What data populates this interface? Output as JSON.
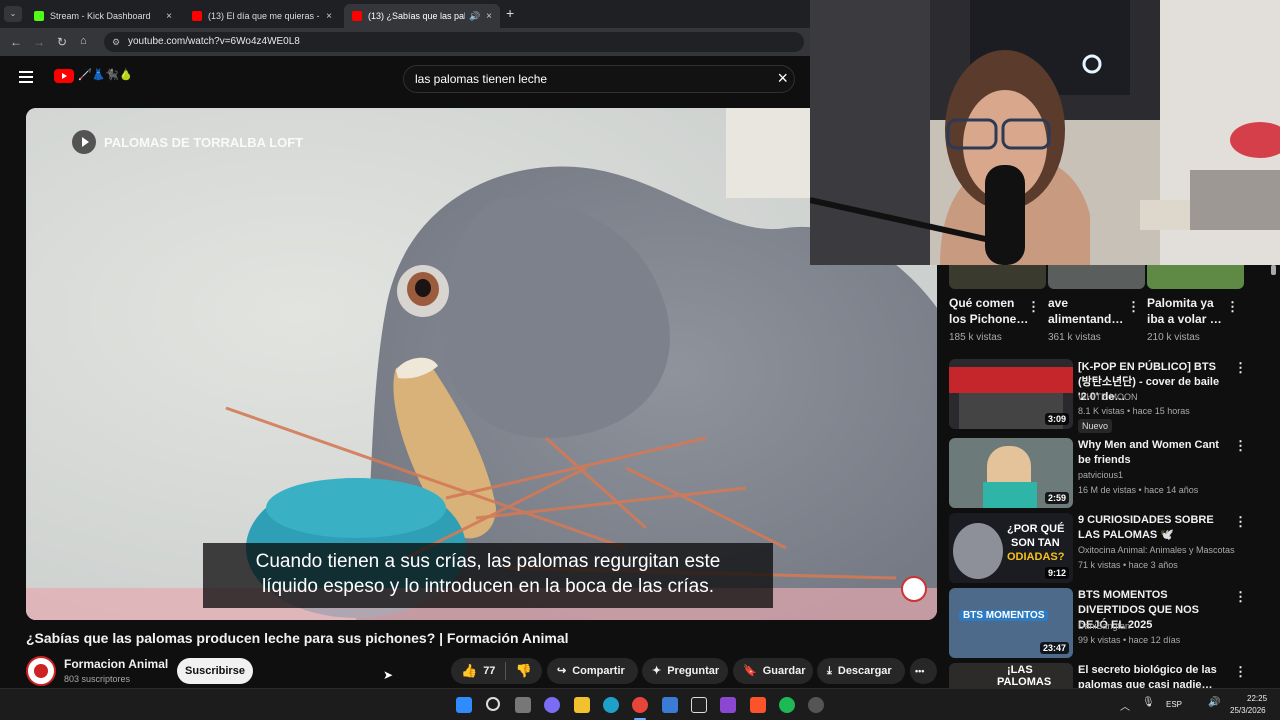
{
  "browser": {
    "tabs": [
      {
        "title": "Stream - Kick Dashboard",
        "close": "×"
      },
      {
        "title": "(13) El día que me quieras - Vid",
        "close": "×"
      },
      {
        "title": "(13) ¿Sabías que las paloma",
        "close": "×"
      }
    ],
    "new_tab": "+",
    "url": "youtube.com/watch?v=6Wo4z4WE0L8",
    "colors": {
      "kick": "#53fc18",
      "youtube": "#ff0000"
    }
  },
  "youtube": {
    "logo_extra": "🦯👗🐈‍⬛🍐",
    "search_query": "las palomas tienen leche",
    "clear_search": "×"
  },
  "video": {
    "overlay_channel": "PALOMAS DE TORRALBA LOFT",
    "caption_line1": "Cuando tienen a sus crías, las palomas regurgitan este",
    "caption_line2": "líquido espeso y lo introducen en la boca de las crías.",
    "title": "¿Sabías que las palomas producen leche para sus pichones? | Formación Animal",
    "channel_name": "Formacion Animal",
    "subscribers": "803 suscriptores",
    "subscribe_label": "Suscribirse",
    "likes": "77",
    "share_label": "Compartir",
    "ask_label": "Preguntar",
    "save_label": "Guardar",
    "download_label": "Descargar",
    "more_label": "•••"
  },
  "shorts": [
    {
      "title_line1": "Qué comen",
      "title_line2": "los Pichone…",
      "views": "185 k vistas"
    },
    {
      "title_line1": "ave",
      "title_line2": "alimentand…",
      "views": "361 k vistas"
    },
    {
      "title_line1": "Palomita ya",
      "title_line2": "iba a volar …",
      "views": "210 k vistas"
    }
  ],
  "recommendations": [
    {
      "title": "[K-POP EN PÚBLICO] BTS (방탄소년단) - cover de baile '2.0' de…",
      "channel": "WHITE MOON",
      "meta": "8.1 K vistas • hace 15 horas",
      "badge": "Nuevo",
      "duration": "3:09"
    },
    {
      "title": "Why Men and Women Cant be friends",
      "channel": "patvicious1",
      "meta": "16 M de vistas • hace 14 años",
      "duration": "2:59"
    },
    {
      "title": "9 CURIOSIDADES SOBRE LAS PALOMAS 🕊️",
      "channel": "Oxitocina Animal: Animales y Mascotas",
      "meta": "71 k vistas • hace 3 años",
      "duration": "9:12",
      "thumb_text1": "¿POR QUÉ",
      "thumb_text2": "SON TAN",
      "thumb_text3": "ODIADAS?"
    },
    {
      "title": "BTS MOMENTOS DIVERTIDOS QUE NOS DEJÓ EL 2025",
      "channel": "DaniBangtan",
      "meta": "99 k vistas • hace 12 días",
      "duration": "23:47",
      "thumb_text1": "BTS MOMENTOS"
    },
    {
      "title": "El secreto biológico de las palomas que casi nadie…",
      "thumb_text1": "¡LAS",
      "thumb_text2": "PALOMAS"
    }
  ],
  "taskbar": {
    "lang": "ESP",
    "time": "22:25",
    "date": "25/3/2026"
  }
}
